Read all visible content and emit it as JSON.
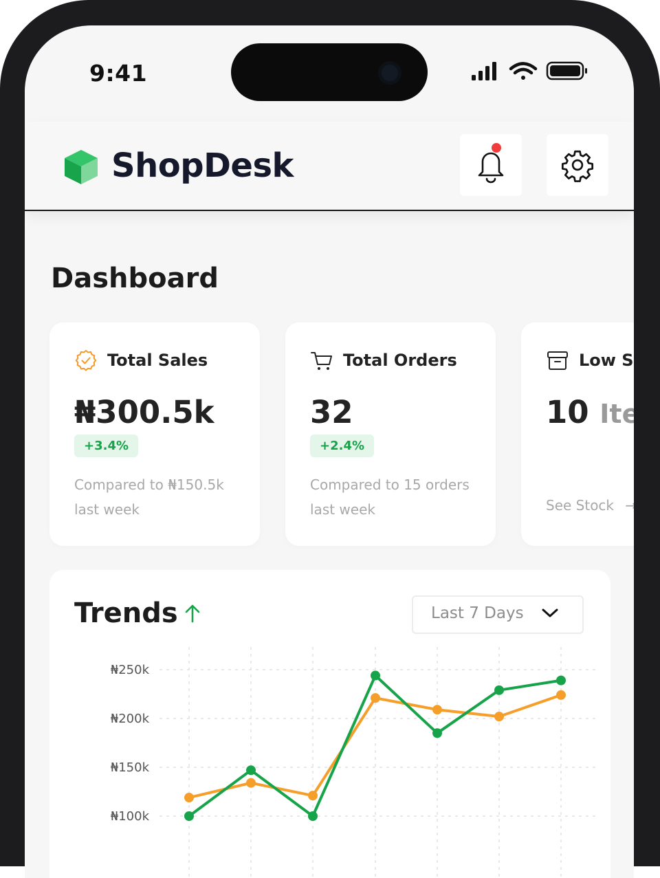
{
  "status_bar": {
    "time": "9:41"
  },
  "header": {
    "brand": "ShopDesk"
  },
  "dashboard": {
    "title": "Dashboard",
    "cards": [
      {
        "label": "Total Sales",
        "value": "₦300.5k",
        "change": "+3.4%",
        "note": "Compared to ₦150.5k last week"
      },
      {
        "label": "Total Orders",
        "value": "32",
        "change": "+2.4%",
        "note": "Compared to 15 orders last week"
      },
      {
        "label": "Low St",
        "value": "10",
        "unit": "Iten",
        "link": "See Stock"
      }
    ]
  },
  "trends": {
    "title": "Trends",
    "range": "Last 7 Days",
    "chart_data": {
      "type": "line",
      "y_ticks": [
        "₦250k",
        "₦200k",
        "₦150k",
        "₦100k"
      ],
      "series": [
        {
          "color": "#16a34a",
          "values": [
            100,
            147,
            100,
            244,
            185,
            229,
            239
          ]
        },
        {
          "color": "#f59e2a",
          "values": [
            119,
            134,
            121,
            221,
            209,
            202,
            224
          ]
        }
      ]
    }
  }
}
